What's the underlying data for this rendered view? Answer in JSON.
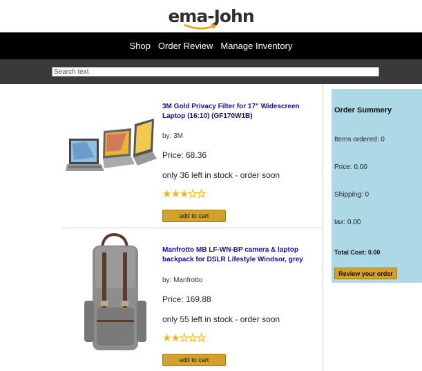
{
  "brand": {
    "logo_text": "ema-John"
  },
  "nav": {
    "items": [
      "Shop",
      "Order Review",
      "Manage Inventory"
    ]
  },
  "search": {
    "placeholder": "Search text"
  },
  "products": [
    {
      "title": "3M Gold Privacy Filter for 17\" Widescreen Laptop (16:10) (GF170W1B)",
      "by": "by: 3M",
      "price": "Price: 68.36",
      "stock": "only 36 left in stock - order soon",
      "rating": 3,
      "button": "add to cart",
      "image_icon": "laptop-privacy-filter-image"
    },
    {
      "title": "Manfrotto MB LF-WN-BP camera & laptop backpack for DSLR Lifestyle Windsor, grey",
      "by": "by: Manfrotto",
      "price": "Price: 169.88",
      "stock": "only 55 left in stock - order soon",
      "rating": 2,
      "button": "add to cart",
      "image_icon": "backpack-image"
    }
  ],
  "summary": {
    "title": "Order Summery",
    "items_ordered": "Items ordered: 0",
    "price": "Price: 0.00",
    "shipping": "Shipping: 0",
    "tax": "tax: 0.00",
    "total": "Total Cost: 0.00",
    "button": "Review your order"
  },
  "colors": {
    "nav_bg": "#000000",
    "search_bg": "#3a3a3a",
    "accent": "#d4a12a",
    "summary_bg": "#add8e6",
    "link": "#1a0dab",
    "star": "#f5b800"
  }
}
